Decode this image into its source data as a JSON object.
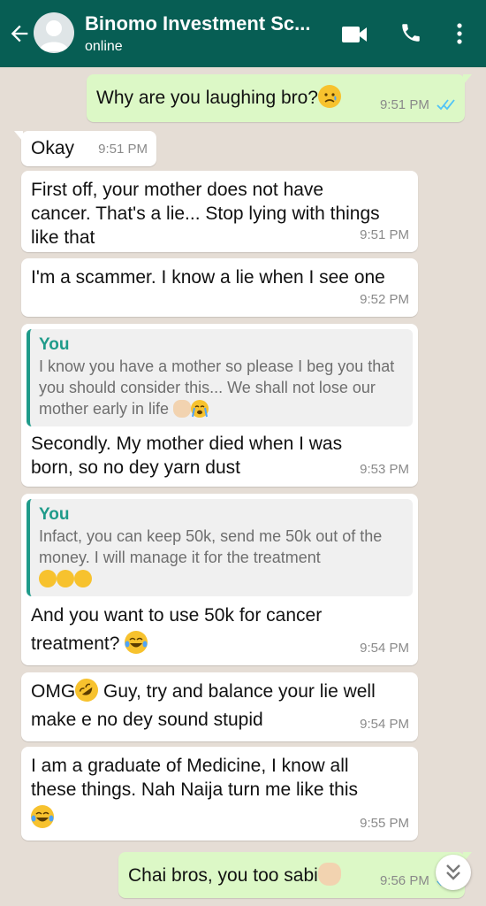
{
  "header": {
    "contact_name": "Binomo Investment Sc...",
    "status": "online",
    "colors": {
      "bar": "#075e54",
      "text": "#ffffff"
    },
    "icons": [
      "back-arrow-icon",
      "avatar",
      "video-call-icon",
      "phone-call-icon",
      "more-vert-icon"
    ]
  },
  "messages": [
    {
      "direction": "out",
      "text": "Why are you laughing bro?",
      "emoji": "sad-face",
      "time": "9:51 PM",
      "status": "read"
    },
    {
      "direction": "in",
      "text": "Okay",
      "time": "9:51 PM"
    },
    {
      "direction": "in",
      "text": "First off, your mother does not have cancer. That's a lie... Stop lying with things like that",
      "time": "9:51 PM"
    },
    {
      "direction": "in",
      "text": "I'm a scammer. I know a lie when I see one",
      "time": "9:52 PM"
    },
    {
      "direction": "in",
      "quote_author": "You",
      "quote_text": "I know you have a mother so please I beg you that you should consider this... We shall not lose our mother early in life",
      "quote_emojis": "folded-hands, crying-face",
      "text": "Secondly. My mother died when I was born, so no dey yarn dust",
      "time": "9:53 PM"
    },
    {
      "direction": "in",
      "quote_author": "You",
      "quote_text": "Infact, you can keep 50k, send me 50k out of the money. I will manage it for the treatment",
      "quote_emojis": "crying-face x3",
      "text": "And you want to use 50k for cancer treatment?",
      "emoji": "tears-of-joy",
      "time": "9:54 PM"
    },
    {
      "direction": "in",
      "text_a": "OMG",
      "emoji": "rolling-on-floor-laughing",
      "text_b": " Guy, try and balance your lie well make e no dey sound stupid",
      "time": "9:54 PM"
    },
    {
      "direction": "in",
      "text": "I am a graduate of Medicine, I know all these things. Nah Naija turn me like this",
      "emoji": "tears-of-joy",
      "time": "9:55 PM"
    },
    {
      "direction": "out",
      "text": "Chai bros, you too sabi",
      "emoji": "raising-hands",
      "time": "9:56 PM",
      "status": "read"
    }
  ],
  "colors": {
    "chat_background": "#e5ddd5",
    "incoming_bubble": "#ffffff",
    "outgoing_bubble": "#dcf8c6",
    "quote_accent": "#1f9b8a",
    "read_ticks": "#4fc3f7"
  },
  "scroll_button_icon": "double-chevron-down-icon"
}
